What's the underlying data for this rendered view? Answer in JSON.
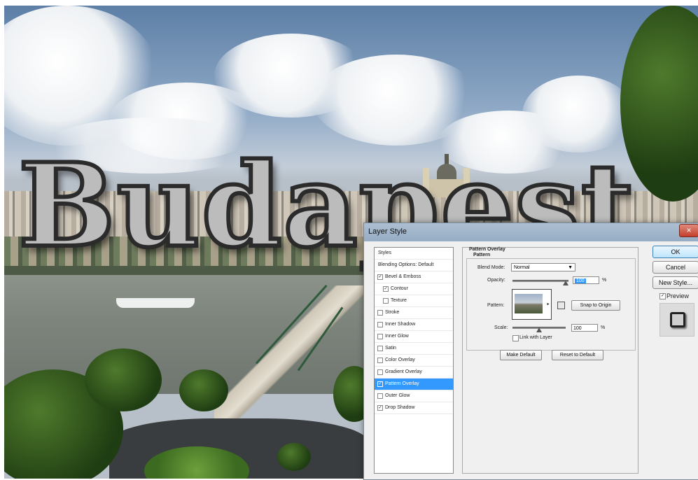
{
  "overlay_text": "Budapest",
  "dialog": {
    "title": "Layer Style",
    "close_icon": "×",
    "styles": [
      {
        "label": "Styles",
        "checkbox": false,
        "checked": false,
        "indent": false
      },
      {
        "label": "Blending Options: Default",
        "checkbox": false,
        "checked": false,
        "indent": false
      },
      {
        "label": "Bevel & Emboss",
        "checkbox": true,
        "checked": true,
        "indent": false
      },
      {
        "label": "Contour",
        "checkbox": true,
        "checked": true,
        "indent": true
      },
      {
        "label": "Texture",
        "checkbox": true,
        "checked": false,
        "indent": true
      },
      {
        "label": "Stroke",
        "checkbox": true,
        "checked": false,
        "indent": false
      },
      {
        "label": "Inner Shadow",
        "checkbox": true,
        "checked": false,
        "indent": false
      },
      {
        "label": "Inner Glow",
        "checkbox": true,
        "checked": false,
        "indent": false
      },
      {
        "label": "Satin",
        "checkbox": true,
        "checked": false,
        "indent": false
      },
      {
        "label": "Color Overlay",
        "checkbox": true,
        "checked": false,
        "indent": false
      },
      {
        "label": "Gradient Overlay",
        "checkbox": true,
        "checked": false,
        "indent": false
      },
      {
        "label": "Pattern Overlay",
        "checkbox": true,
        "checked": true,
        "indent": false,
        "selected": true
      },
      {
        "label": "Outer Glow",
        "checkbox": true,
        "checked": false,
        "indent": false
      },
      {
        "label": "Drop Shadow",
        "checkbox": true,
        "checked": true,
        "indent": false
      }
    ],
    "panel": {
      "section_title": "Pattern Overlay",
      "group_title": "Pattern",
      "blend_mode_label": "Blend Mode:",
      "blend_mode_value": "Normal",
      "opacity_label": "Opacity:",
      "opacity_value": "100",
      "opacity_unit": "%",
      "opacity_level": 1.0,
      "pattern_label": "Pattern:",
      "snap_button": "Snap to Origin",
      "scale_label": "Scale:",
      "scale_value": "100",
      "scale_unit": "%",
      "scale_level": 0.5,
      "link_label": "Link with Layer",
      "link_checked": false,
      "make_default_button": "Make Default",
      "reset_default_button": "Reset to Default"
    },
    "buttons": {
      "ok": "OK",
      "cancel": "Cancel",
      "new_style": "New Style...",
      "preview_label": "Preview",
      "preview_checked": true
    },
    "check_mark": "✓",
    "dropdown_icon": "▼",
    "pattern_arrow_icon": "▸"
  }
}
